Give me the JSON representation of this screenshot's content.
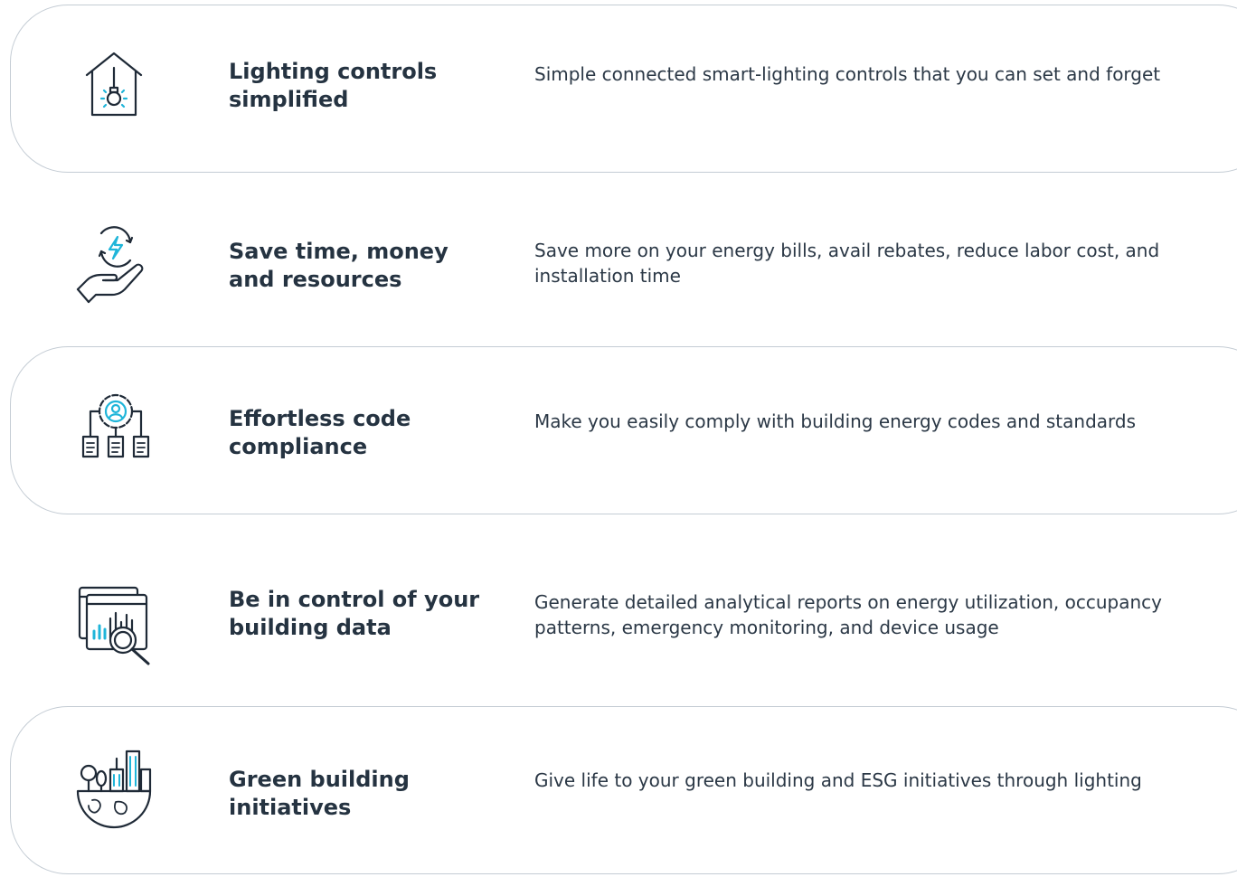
{
  "colors": {
    "icon_dark": "#1f2a37",
    "icon_accent": "#1fb5d9",
    "card_border": "#c4ccd4"
  },
  "features": [
    {
      "icon": "house-lightbulb-icon",
      "title": "Lighting controls simplified",
      "description": "Simple connected smart-lighting controls that you can set and forget"
    },
    {
      "icon": "hand-energy-icon",
      "title": "Save time, money and resources",
      "description": "Save more on your energy bills, avail rebates, reduce labor cost, and installation time"
    },
    {
      "icon": "gear-documents-icon",
      "title": "Effortless code compliance",
      "description": "Make you easily comply with building energy codes and standards"
    },
    {
      "icon": "analytics-magnifier-icon",
      "title": "Be in control of your building data",
      "description": "Generate detailed analytical reports on energy utilization, occupancy patterns, emergency monitoring, and device usage"
    },
    {
      "icon": "green-city-globe-icon",
      "title": "Green building initiatives",
      "description": "Give life to your green building and ESG initiatives through lighting"
    }
  ]
}
